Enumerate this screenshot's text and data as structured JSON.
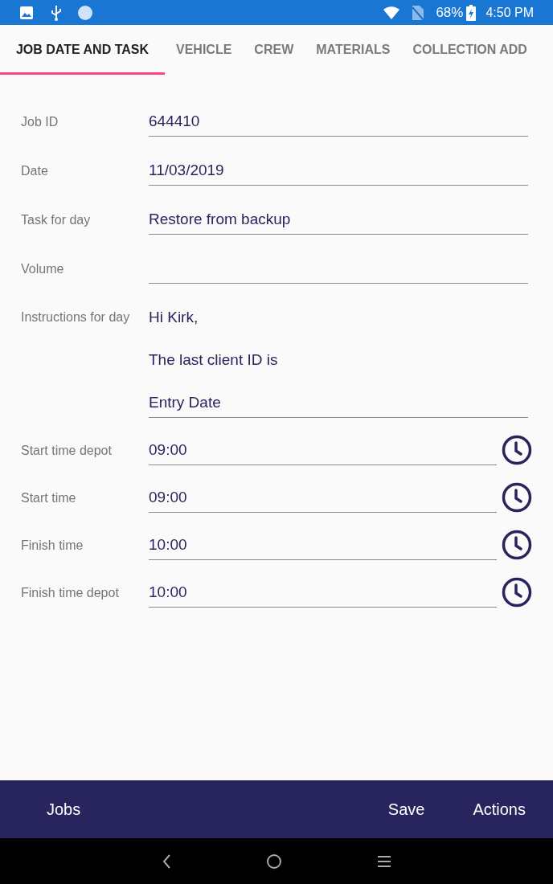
{
  "status_bar": {
    "battery": "68%",
    "time": "4:50 PM"
  },
  "tabs": [
    {
      "label": "JOB DATE AND TASK",
      "selected": true
    },
    {
      "label": "VEHICLE",
      "selected": false
    },
    {
      "label": "CREW",
      "selected": false
    },
    {
      "label": "MATERIALS",
      "selected": false
    },
    {
      "label": "COLLECTION ADD",
      "selected": false
    }
  ],
  "fields": [
    {
      "kind": "text",
      "label": "Job ID",
      "value": "644410"
    },
    {
      "kind": "text",
      "label": "Date",
      "value": "11/03/2019"
    },
    {
      "kind": "text",
      "label": "Task for day",
      "value": "Restore from backup"
    },
    {
      "kind": "text",
      "label": "Volume"
    },
    {
      "kind": "multiline",
      "label": "Instructions for day",
      "lines": [
        "Hi Kirk,",
        "The last client ID is",
        "Entry Date"
      ]
    },
    {
      "kind": "time",
      "label": "Start time depot",
      "value": "09:00"
    },
    {
      "kind": "time",
      "label": "Start time",
      "value": "09:00"
    },
    {
      "kind": "time",
      "label": "Finish time",
      "value": "10:00"
    },
    {
      "kind": "time",
      "label": "Finish time depot",
      "value": "10:00"
    }
  ],
  "bottom_bar": {
    "left": [
      "Jobs"
    ],
    "right": [
      "Save",
      "Actions"
    ]
  }
}
